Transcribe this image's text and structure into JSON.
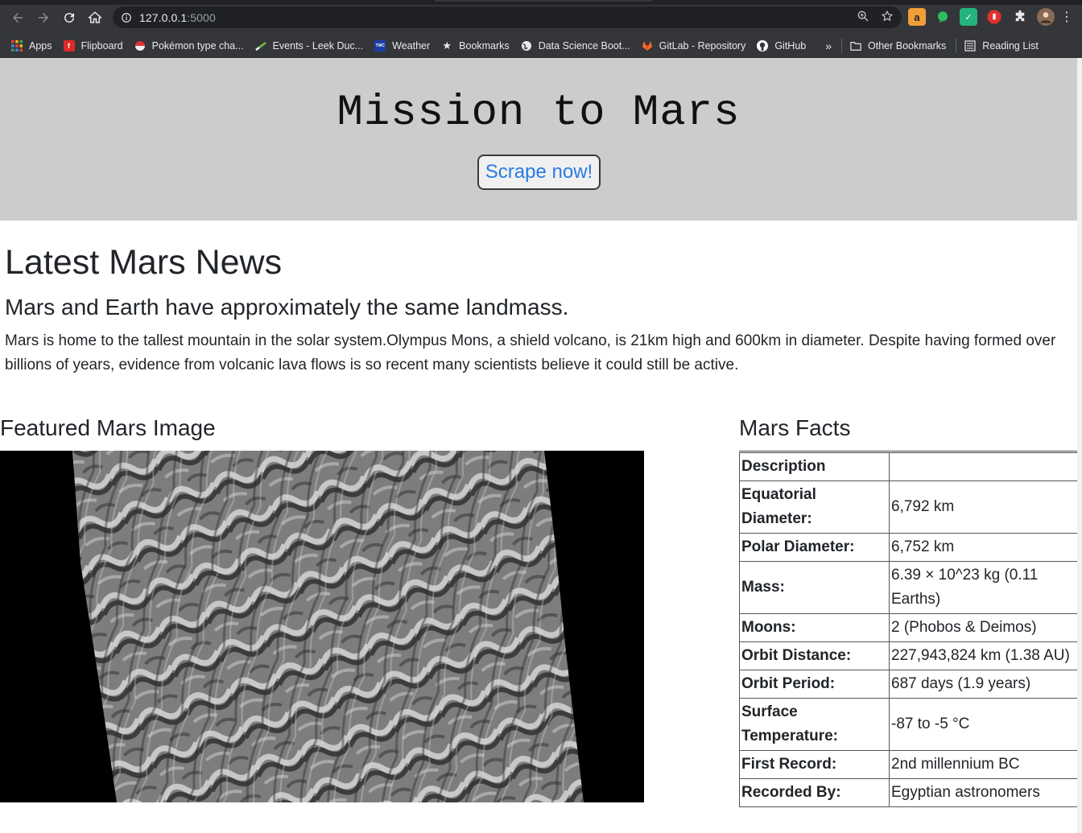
{
  "browser": {
    "url_host": "127.0.0.1",
    "url_port": ":5000",
    "bookmarks": [
      {
        "label": "Apps",
        "icon": "apps-grid-icon",
        "color": "#ea4335"
      },
      {
        "label": "Flipboard",
        "icon": "flipboard-icon",
        "color": "#e12828"
      },
      {
        "label": "Pokémon type cha...",
        "icon": "pokeball-icon",
        "color": "#c0392b"
      },
      {
        "label": "Events - Leek Duc...",
        "icon": "leek-icon",
        "color": "#4caf50"
      },
      {
        "label": "Weather",
        "icon": "weather-channel-icon",
        "color": "#1a3da8"
      },
      {
        "label": "Bookmarks",
        "icon": "star-icon",
        "color": "#e8eaed"
      },
      {
        "label": "Data Science Boot...",
        "icon": "globe-icon",
        "color": "#e8eaed"
      },
      {
        "label": "GitLab - Repository",
        "icon": "gitlab-icon",
        "color": "#fc6d26"
      },
      {
        "label": "GitHub",
        "icon": "github-icon",
        "color": "#ffffff"
      }
    ],
    "overflow": "»",
    "other_bookmarks": "Other Bookmarks",
    "reading_list": "Reading List"
  },
  "page": {
    "title": "Mission to Mars",
    "scrape_button": "Scrape now!",
    "news_section_title": "Latest Mars News",
    "news_headline": "Mars and Earth have approximately the same landmass.",
    "news_body": "Mars is home to the tallest mountain in the solar system.Olympus Mons, a shield volcano, is 21km high and 600km in diameter. Despite having formed over billions of years, evidence from volcanic lava flows is so recent many scientists believe it could still be active.",
    "featured_title": "Featured Mars Image",
    "facts_title": "Mars Facts",
    "facts": [
      {
        "k": "Description",
        "v": ""
      },
      {
        "k": "Equatorial Diameter:",
        "v": "6,792 km"
      },
      {
        "k": "Polar Diameter:",
        "v": "6,752 km"
      },
      {
        "k": "Mass:",
        "v": "6.39 × 10^23 kg (0.11 Earths)"
      },
      {
        "k": "Moons:",
        "v": "2 (Phobos & Deimos)"
      },
      {
        "k": "Orbit Distance:",
        "v": "227,943,824 km (1.38 AU)"
      },
      {
        "k": "Orbit Period:",
        "v": "687 days (1.9 years)"
      },
      {
        "k": "Surface Temperature:",
        "v": "-87 to -5 °C"
      },
      {
        "k": "First Record:",
        "v": "2nd millennium BC"
      },
      {
        "k": "Recorded By:",
        "v": "Egyptian astronomers"
      }
    ]
  }
}
